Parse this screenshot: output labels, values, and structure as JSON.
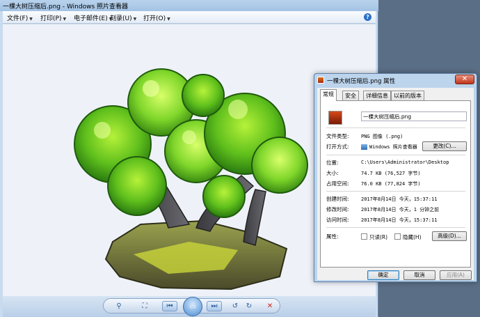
{
  "viewer": {
    "title": "一棵大树压缩后.png - Windows 照片查看器",
    "menu": [
      {
        "label": "文件(F)"
      },
      {
        "label": "打印(P)"
      },
      {
        "label": "电子邮件(E)"
      },
      {
        "label": "刻录(U)"
      },
      {
        "label": "打开(O)"
      }
    ],
    "help_label": "?",
    "toolbar": {
      "zoom_icon": "magnifier-icon",
      "fit_icon": "actual-size-icon",
      "prev_icon": "previous-icon",
      "slideshow_icon": "slideshow-icon",
      "next_icon": "next-icon",
      "rotate_ccw_icon": "rotate-ccw-icon",
      "rotate_cw_icon": "rotate-cw-icon",
      "delete_icon": "delete-icon"
    }
  },
  "props": {
    "title": "一棵大树压缩后.png 属性",
    "close_label": "✕",
    "tabs": [
      {
        "label": "常规"
      },
      {
        "label": "安全"
      },
      {
        "label": "详细信息"
      },
      {
        "label": "以前的版本"
      }
    ],
    "file_name": "一棵大树压缩后.png",
    "file_type_label": "文件类型:",
    "file_type_value": "PNG 图像 (.png)",
    "open_with_label": "打开方式:",
    "open_with_value": "Windows 照片查看器",
    "change_button": "更改(C)...",
    "location_label": "位置:",
    "location_value": "C:\\Users\\Administrator\\Desktop",
    "size_label": "大小:",
    "size_value": "74.7 KB (76,527 字节)",
    "disk_size_label": "占用空间:",
    "disk_size_value": "76.0 KB (77,824 字节)",
    "created_label": "创建时间:",
    "created_value": "2017年8月14日 今天，15:37:11",
    "modified_label": "修改时间:",
    "modified_value": "2017年8月14日 今天，1 分钟之前",
    "accessed_label": "访问时间:",
    "accessed_value": "2017年8月14日 今天，15:37:11",
    "attributes_label": "属性:",
    "readonly_label": "只读(R)",
    "hidden_label": "隐藏(H)",
    "advanced_button": "高级(D)...",
    "ok_button": "确定",
    "cancel_button": "取消",
    "apply_button": "应用(A)"
  }
}
